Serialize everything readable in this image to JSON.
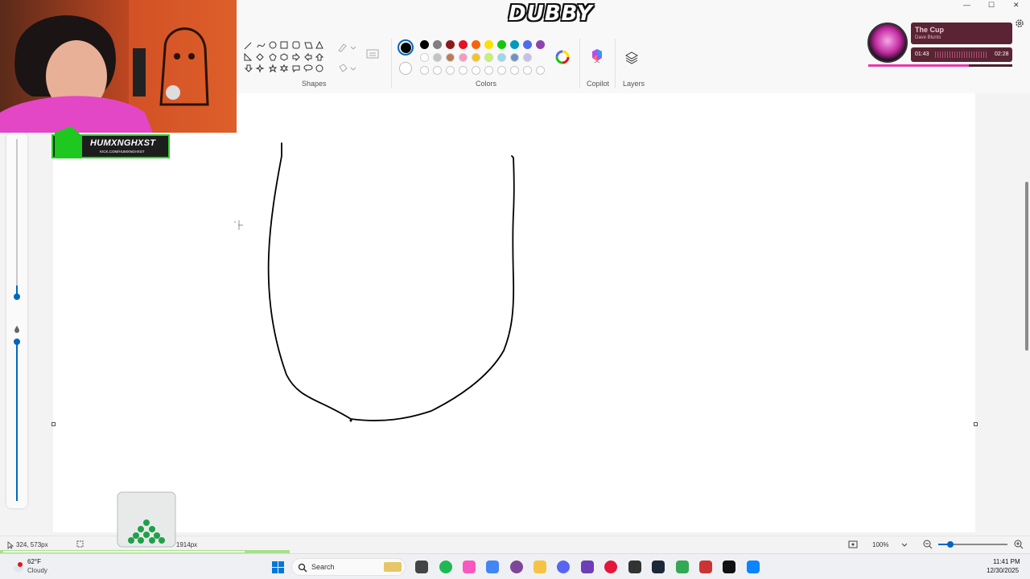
{
  "ribbon": {
    "shapes_label": "Shapes",
    "colors_label": "Colors",
    "copilot_label": "Copilot",
    "layers_label": "Layers",
    "palette_row1": [
      "#000000",
      "#7f7f7f",
      "#8b1a1a",
      "#e81123",
      "#f7630c",
      "#fce100",
      "#16c60c",
      "#0099bc",
      "#4f6bed",
      "#8e44ad"
    ],
    "palette_row2": [
      "#ffffff",
      "#c3c3c3",
      "#b97a57",
      "#f49ac1",
      "#f7c31e",
      "#c7f464",
      "#99d9ea",
      "#7092be",
      "#c8bfe7"
    ],
    "selected_color": "#000000"
  },
  "window": {
    "minimize": "—",
    "maximize": "☐",
    "close": "✕"
  },
  "statusbar": {
    "cursor_pos": "324, 573px",
    "canvas_size": "× 1914px",
    "zoom_value": "100%"
  },
  "taskbar": {
    "weather_temp": "62°F",
    "weather_desc": "Cloudy",
    "search_placeholder": "Search",
    "time": "11:41 PM",
    "date": "12/30/2025"
  },
  "overlay": {
    "streamer_name": "HUMXNGHXST",
    "streamer_sub": "KICK.COM/HUMXNGHXST",
    "channel_logo": "DUBBY",
    "song_title": "The Cup",
    "song_artist": "Dave Blunts",
    "song_elapsed": "01:43",
    "song_total": "02:28",
    "song_progress": 0.7
  },
  "colors": {
    "accent": "#0067c0",
    "overlay_pink": "#e83aa8",
    "name_green": "#2ad22a"
  }
}
